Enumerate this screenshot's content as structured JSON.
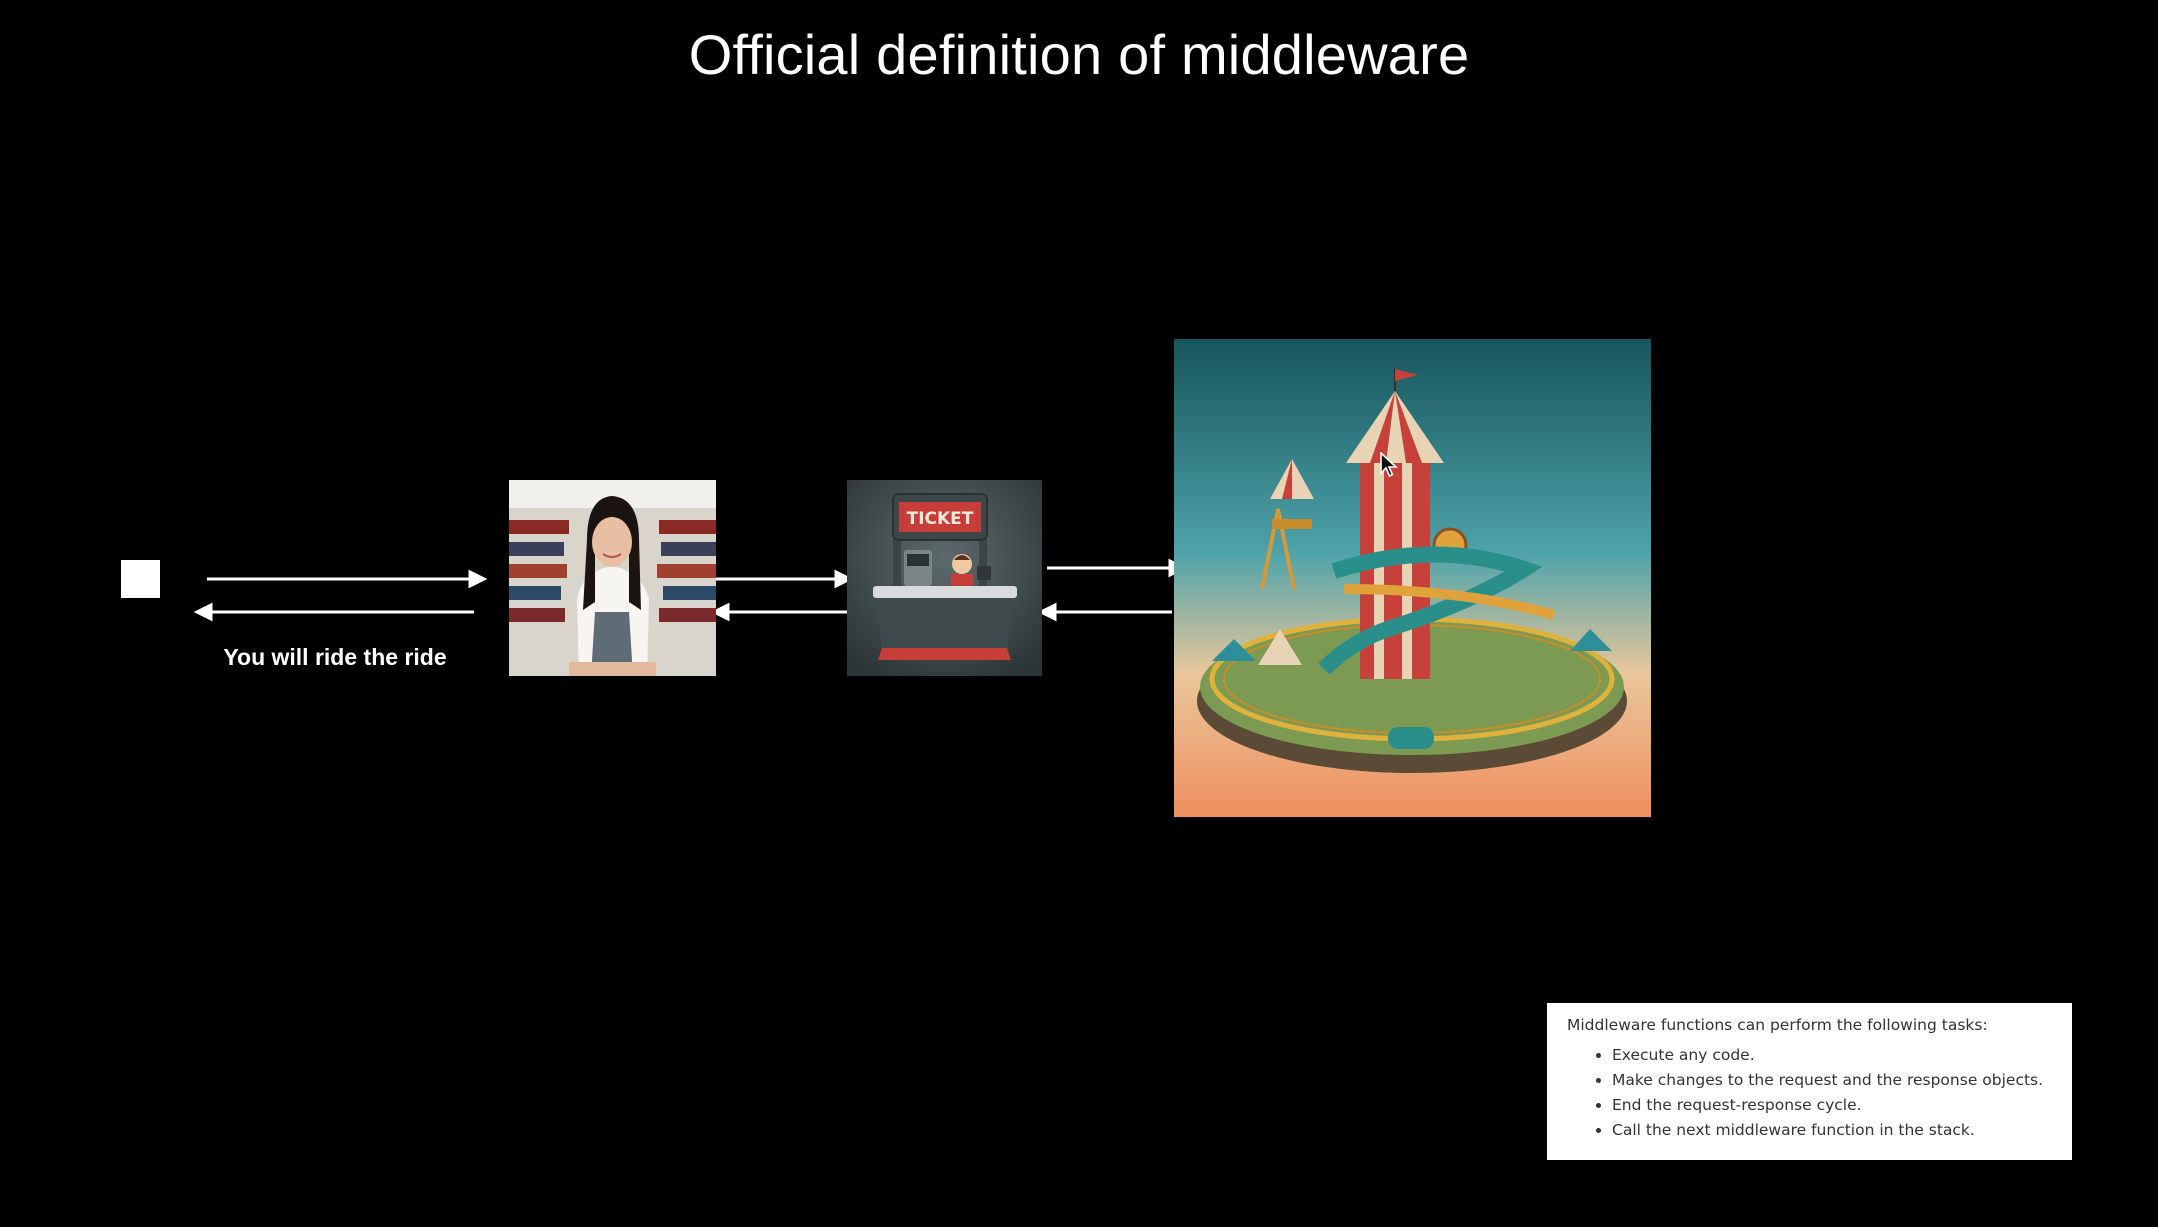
{
  "slide": {
    "title": "Official definition of middleware",
    "caption": "You will ride the ride"
  },
  "images": {
    "cashier": "cashier-photo",
    "ticket_booth": "ticket-booth-illustration",
    "ticket_sign": "TICKET",
    "amusement_park": "amusement-park-illustration"
  },
  "info_box": {
    "intro": "Middleware functions can perform the following tasks:",
    "items": [
      "Execute any code.",
      "Make changes to the request and the response objects.",
      "End the request-response cycle.",
      "Call the next middleware function in the stack."
    ]
  },
  "colors": {
    "background": "#000000",
    "foreground": "#ffffff"
  }
}
